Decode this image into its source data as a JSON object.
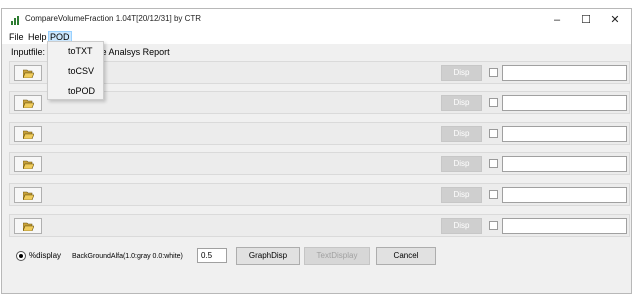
{
  "window": {
    "title": "CompareVolumeFraction 1.04T[20/12/31] by CTR",
    "controls": {
      "minimize": "–",
      "maximize": "☐",
      "close": "✕"
    }
  },
  "menu": {
    "file": "File",
    "help": "Help",
    "pod": "POD"
  },
  "pod_menu": {
    "items": [
      "toTXT",
      "toCSV",
      "toPOD"
    ]
  },
  "inputfile_label": "Inputfile: I          re Quantetive Analsys Report",
  "rows": [
    {
      "disp_label": "Disp"
    },
    {
      "disp_label": "Disp"
    },
    {
      "disp_label": "Disp"
    },
    {
      "disp_label": "Disp"
    },
    {
      "disp_label": "Disp"
    },
    {
      "disp_label": "Disp"
    }
  ],
  "bottom": {
    "percent_display_label": "%display",
    "percent_display_checked": true,
    "alpha_label": "BackGroundAlfa(1.0:gray  0.0:white)",
    "alpha_value": "0.5",
    "graph_disp_label": "GraphDisp",
    "text_display_label": "TextDisplay",
    "cancel_label": "Cancel"
  },
  "icons": {
    "app": "app-chart-icon",
    "folder": "open-folder-icon"
  },
  "colors": {
    "menu_highlight": "#cce8ff",
    "disabled_button": "#cfcfcf",
    "app_icon_green": "#2e7d32"
  }
}
